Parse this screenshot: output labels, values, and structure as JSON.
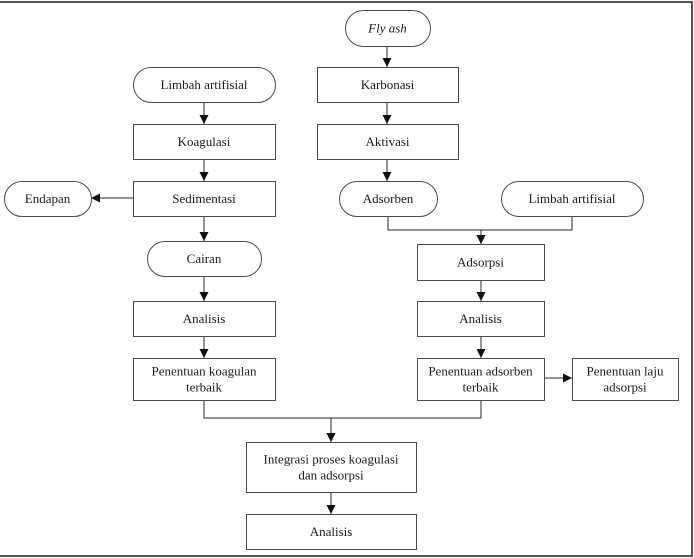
{
  "diagram": {
    "type": "flowchart",
    "nodes": [
      {
        "id": "fly_ash",
        "shape": "terminator",
        "lines": [
          "Fly ash"
        ],
        "italic": true
      },
      {
        "id": "limbah_left",
        "shape": "terminator",
        "lines": [
          "Limbah artifisial"
        ]
      },
      {
        "id": "karbonasi",
        "shape": "process",
        "lines": [
          "Karbonasi"
        ]
      },
      {
        "id": "koagulasi",
        "shape": "process",
        "lines": [
          "Koagulasi"
        ]
      },
      {
        "id": "aktivasi",
        "shape": "process",
        "lines": [
          "Aktivasi"
        ]
      },
      {
        "id": "endapan",
        "shape": "terminator",
        "lines": [
          "Endapan"
        ]
      },
      {
        "id": "sedimentasi",
        "shape": "process",
        "lines": [
          "Sedimentasi"
        ]
      },
      {
        "id": "adsorben",
        "shape": "terminator",
        "lines": [
          "Adsorben"
        ]
      },
      {
        "id": "limbah_right",
        "shape": "terminator",
        "lines": [
          "Limbah artifisial"
        ]
      },
      {
        "id": "cairan",
        "shape": "terminator",
        "lines": [
          "Cairan"
        ]
      },
      {
        "id": "adsorpsi",
        "shape": "process",
        "lines": [
          "Adsorpsi"
        ]
      },
      {
        "id": "analisis_left",
        "shape": "process",
        "lines": [
          "Analisis"
        ]
      },
      {
        "id": "analisis_right",
        "shape": "process",
        "lines": [
          "Analisis"
        ]
      },
      {
        "id": "penentuan_koagulan",
        "shape": "process",
        "lines": [
          "Penentuan koagulan",
          "terbaik"
        ]
      },
      {
        "id": "penentuan_adsorben",
        "shape": "process",
        "lines": [
          "Penentuan adsorben",
          "terbaik"
        ]
      },
      {
        "id": "penentuan_laju",
        "shape": "process",
        "lines": [
          "Penentuan laju",
          "adsorpsi"
        ]
      },
      {
        "id": "integrasi",
        "shape": "process",
        "lines": [
          "Integrasi proses koagulasi",
          "dan adsorpsi"
        ]
      },
      {
        "id": "analisis_final",
        "shape": "process",
        "lines": [
          "Analisis"
        ]
      }
    ],
    "edges": [
      {
        "from": "fly_ash",
        "to": "karbonasi"
      },
      {
        "from": "karbonasi",
        "to": "aktivasi"
      },
      {
        "from": "aktivasi",
        "to": "adsorben"
      },
      {
        "from": "limbah_left",
        "to": "koagulasi"
      },
      {
        "from": "koagulasi",
        "to": "sedimentasi"
      },
      {
        "from": "sedimentasi",
        "to": "endapan"
      },
      {
        "from": "sedimentasi",
        "to": "cairan"
      },
      {
        "from": "cairan",
        "to": "analisis_left"
      },
      {
        "from": "analisis_left",
        "to": "penentuan_koagulan"
      },
      {
        "from": "adsorben",
        "to": "adsorpsi"
      },
      {
        "from": "limbah_right",
        "to": "adsorpsi"
      },
      {
        "from": "adsorpsi",
        "to": "analisis_right"
      },
      {
        "from": "analisis_right",
        "to": "penentuan_adsorben"
      },
      {
        "from": "penentuan_adsorben",
        "to": "penentuan_laju"
      },
      {
        "from": "penentuan_koagulan",
        "to": "integrasi"
      },
      {
        "from": "penentuan_adsorben",
        "to": "integrasi"
      },
      {
        "from": "integrasi",
        "to": "analisis_final"
      }
    ]
  }
}
